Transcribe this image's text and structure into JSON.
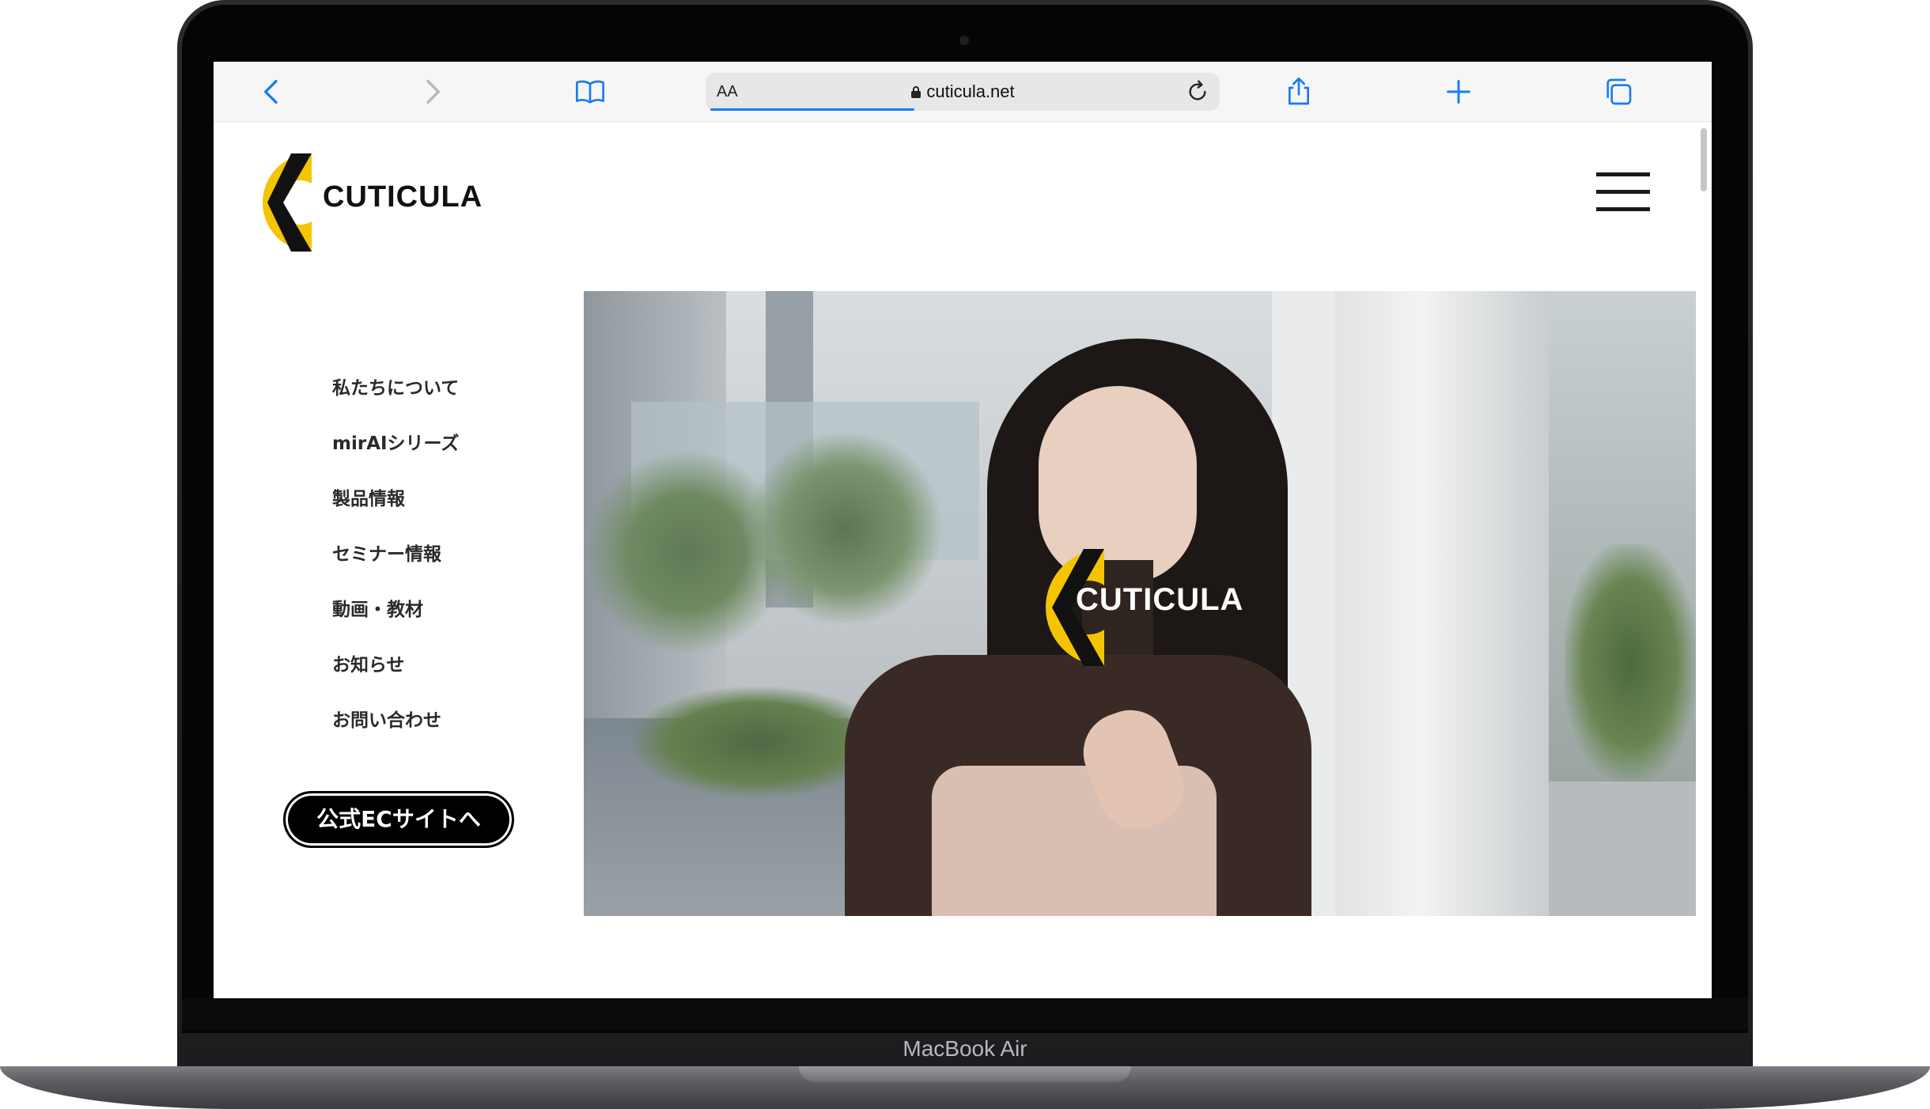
{
  "device": {
    "model_label": "MacBook Air"
  },
  "browser": {
    "text_size_label": "AA",
    "url": "cuticula.net",
    "icons": {
      "back": "chevron-left-icon",
      "forward": "chevron-right-icon",
      "bookmarks": "book-icon",
      "lock": "lock-icon",
      "reload": "reload-icon",
      "share": "share-icon",
      "new_tab": "plus-icon",
      "tabs": "tabs-icon"
    },
    "accent_color": "#1a7bf0"
  },
  "site": {
    "logo_text": "CUTICULA",
    "brand_colors": {
      "yellow": "#f5c400",
      "black": "#111111"
    },
    "nav": [
      {
        "label": "私たちについて"
      },
      {
        "label": "mirAIシリーズ"
      },
      {
        "label": "製品情報"
      },
      {
        "label": "セミナー情報"
      },
      {
        "label": "動画・教材"
      },
      {
        "label": "お知らせ"
      },
      {
        "label": "お問い合わせ"
      }
    ],
    "ec_button_label": "公式ECサイトへ",
    "hero": {
      "overlay_logo_text": "CUTICULA"
    },
    "menu_icon": "hamburger-menu-icon"
  }
}
